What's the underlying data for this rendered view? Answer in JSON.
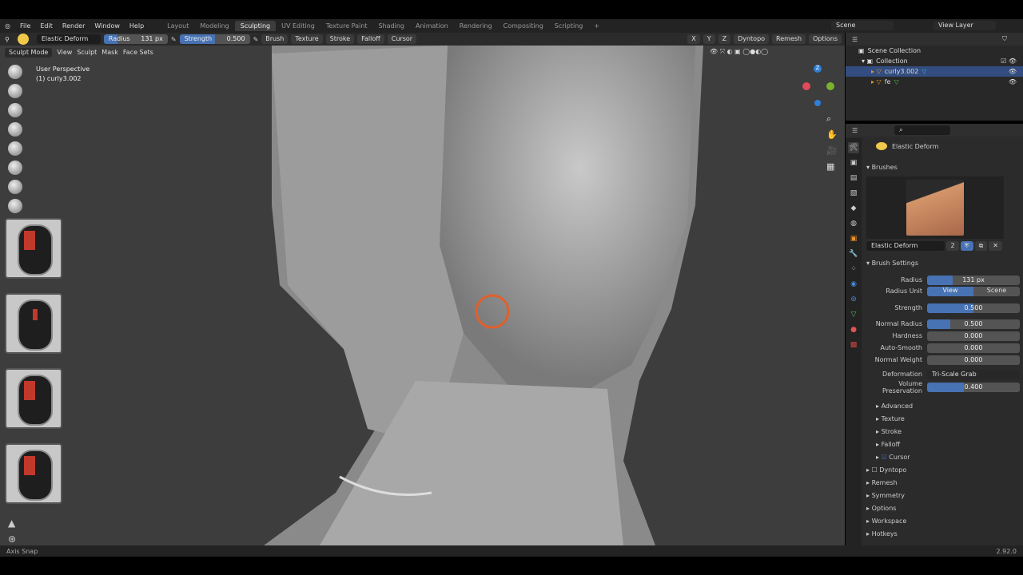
{
  "menu": {
    "items": [
      "File",
      "Edit",
      "Render",
      "Window",
      "Help"
    ],
    "workspaces": [
      "Layout",
      "Modeling",
      "Sculpting",
      "UV Editing",
      "Texture Paint",
      "Shading",
      "Animation",
      "Rendering",
      "Compositing",
      "Scripting"
    ],
    "active_workspace": "Sculpting",
    "scene": "Scene",
    "view_layer": "View Layer"
  },
  "tool_header": {
    "brush_name": "Elastic Deform",
    "radius_label": "Radius",
    "radius_value": "131 px",
    "strength_label": "Strength",
    "strength_value": "0.500",
    "strength_fraction": 0.5,
    "dropdowns": [
      "Brush",
      "Texture",
      "Stroke",
      "Falloff",
      "Cursor"
    ],
    "right": [
      "X",
      "Y",
      "Z",
      "Dyntopo",
      "Remesh",
      "Options"
    ]
  },
  "viewport": {
    "mode": "Sculpt Mode",
    "menus": [
      "View",
      "Sculpt",
      "Mask",
      "Face Sets"
    ],
    "perspective": "User Perspective",
    "object": "(1) curly3.002",
    "gizmo_axis": "Z"
  },
  "outliner": {
    "root": "Scene Collection",
    "collection": "Collection",
    "objects": [
      "curly3.002",
      "fe"
    ],
    "selected": "curly3.002"
  },
  "properties": {
    "brush_name": "Elastic Deform",
    "brushes_label": "Brushes",
    "brush_users": "2",
    "brush_settings_label": "Brush Settings",
    "fields": [
      {
        "label": "Radius",
        "value": "131 px",
        "fill": 0.28
      },
      {
        "label": "Strength",
        "value": "0.500",
        "fill": 0.5
      },
      {
        "label": "Normal Radius",
        "value": "0.500",
        "fill": 0.25
      },
      {
        "label": "Hardness",
        "value": "0.000",
        "fill": 0
      },
      {
        "label": "Auto-Smooth",
        "value": "0.000",
        "fill": 0
      },
      {
        "label": "Normal Weight",
        "value": "0.000",
        "fill": 0
      },
      {
        "label": "Volume Preservation",
        "value": "0.400",
        "fill": 0.4
      }
    ],
    "radius_unit_label": "Radius Unit",
    "radius_unit_options": [
      "View",
      "Scene"
    ],
    "radius_unit_selected": "View",
    "deformation_label": "Deformation",
    "deformation_value": "Tri-Scale Grab",
    "subpanels": [
      "Advanced",
      "Texture",
      "Stroke",
      "Falloff",
      "Cursor"
    ],
    "panels": [
      "Dyntopo",
      "Remesh",
      "Symmetry",
      "Options",
      "Workspace",
      "Hotkeys"
    ]
  },
  "status": {
    "left": "Axis Snap",
    "version": "2.92.0"
  },
  "colors": {
    "accent": "#4772b3",
    "brush_cursor": "#e0602a",
    "selected_row": "#334d80"
  }
}
